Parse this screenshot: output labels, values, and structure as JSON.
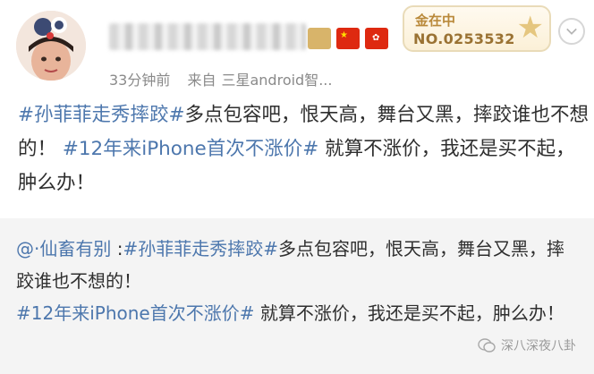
{
  "header": {
    "timestamp": "33分钟前",
    "source_prefix": "来自",
    "source_device": "三星android智...",
    "vip_title": "金在中",
    "vip_number": "NO.0253532"
  },
  "post": {
    "segments": [
      {
        "type": "tag",
        "text": "#孙菲菲走秀摔跤#"
      },
      {
        "type": "text",
        "text": "多点包容吧，恨天高，舞台又黑，摔跤谁也不想的！ "
      },
      {
        "type": "tag",
        "text": "#12年来iPhone首次不涨价#"
      },
      {
        "type": "text",
        "text": " 就算不涨价，我还是买不起，肿么办！"
      }
    ]
  },
  "repost": {
    "segments": [
      {
        "type": "tag",
        "text": "@·仙畜有别"
      },
      {
        "type": "text",
        "text": " :"
      },
      {
        "type": "tag",
        "text": "#孙菲菲走秀摔跤#"
      },
      {
        "type": "text",
        "text": "多点包容吧，恨天高，舞台又黑，摔跤谁也不想的！"
      },
      {
        "type": "break"
      },
      {
        "type": "tag",
        "text": "#12年来iPhone首次不涨价#"
      },
      {
        "type": "text",
        "text": " 就算不涨价，我还是买不起，肿么办！"
      }
    ]
  },
  "watermark": "深八深夜八卦",
  "colors": {
    "link": "#4d77ad",
    "text": "#2f2f2f",
    "meta": "#8a8a8a",
    "repost_bg": "#f4f4f4"
  }
}
